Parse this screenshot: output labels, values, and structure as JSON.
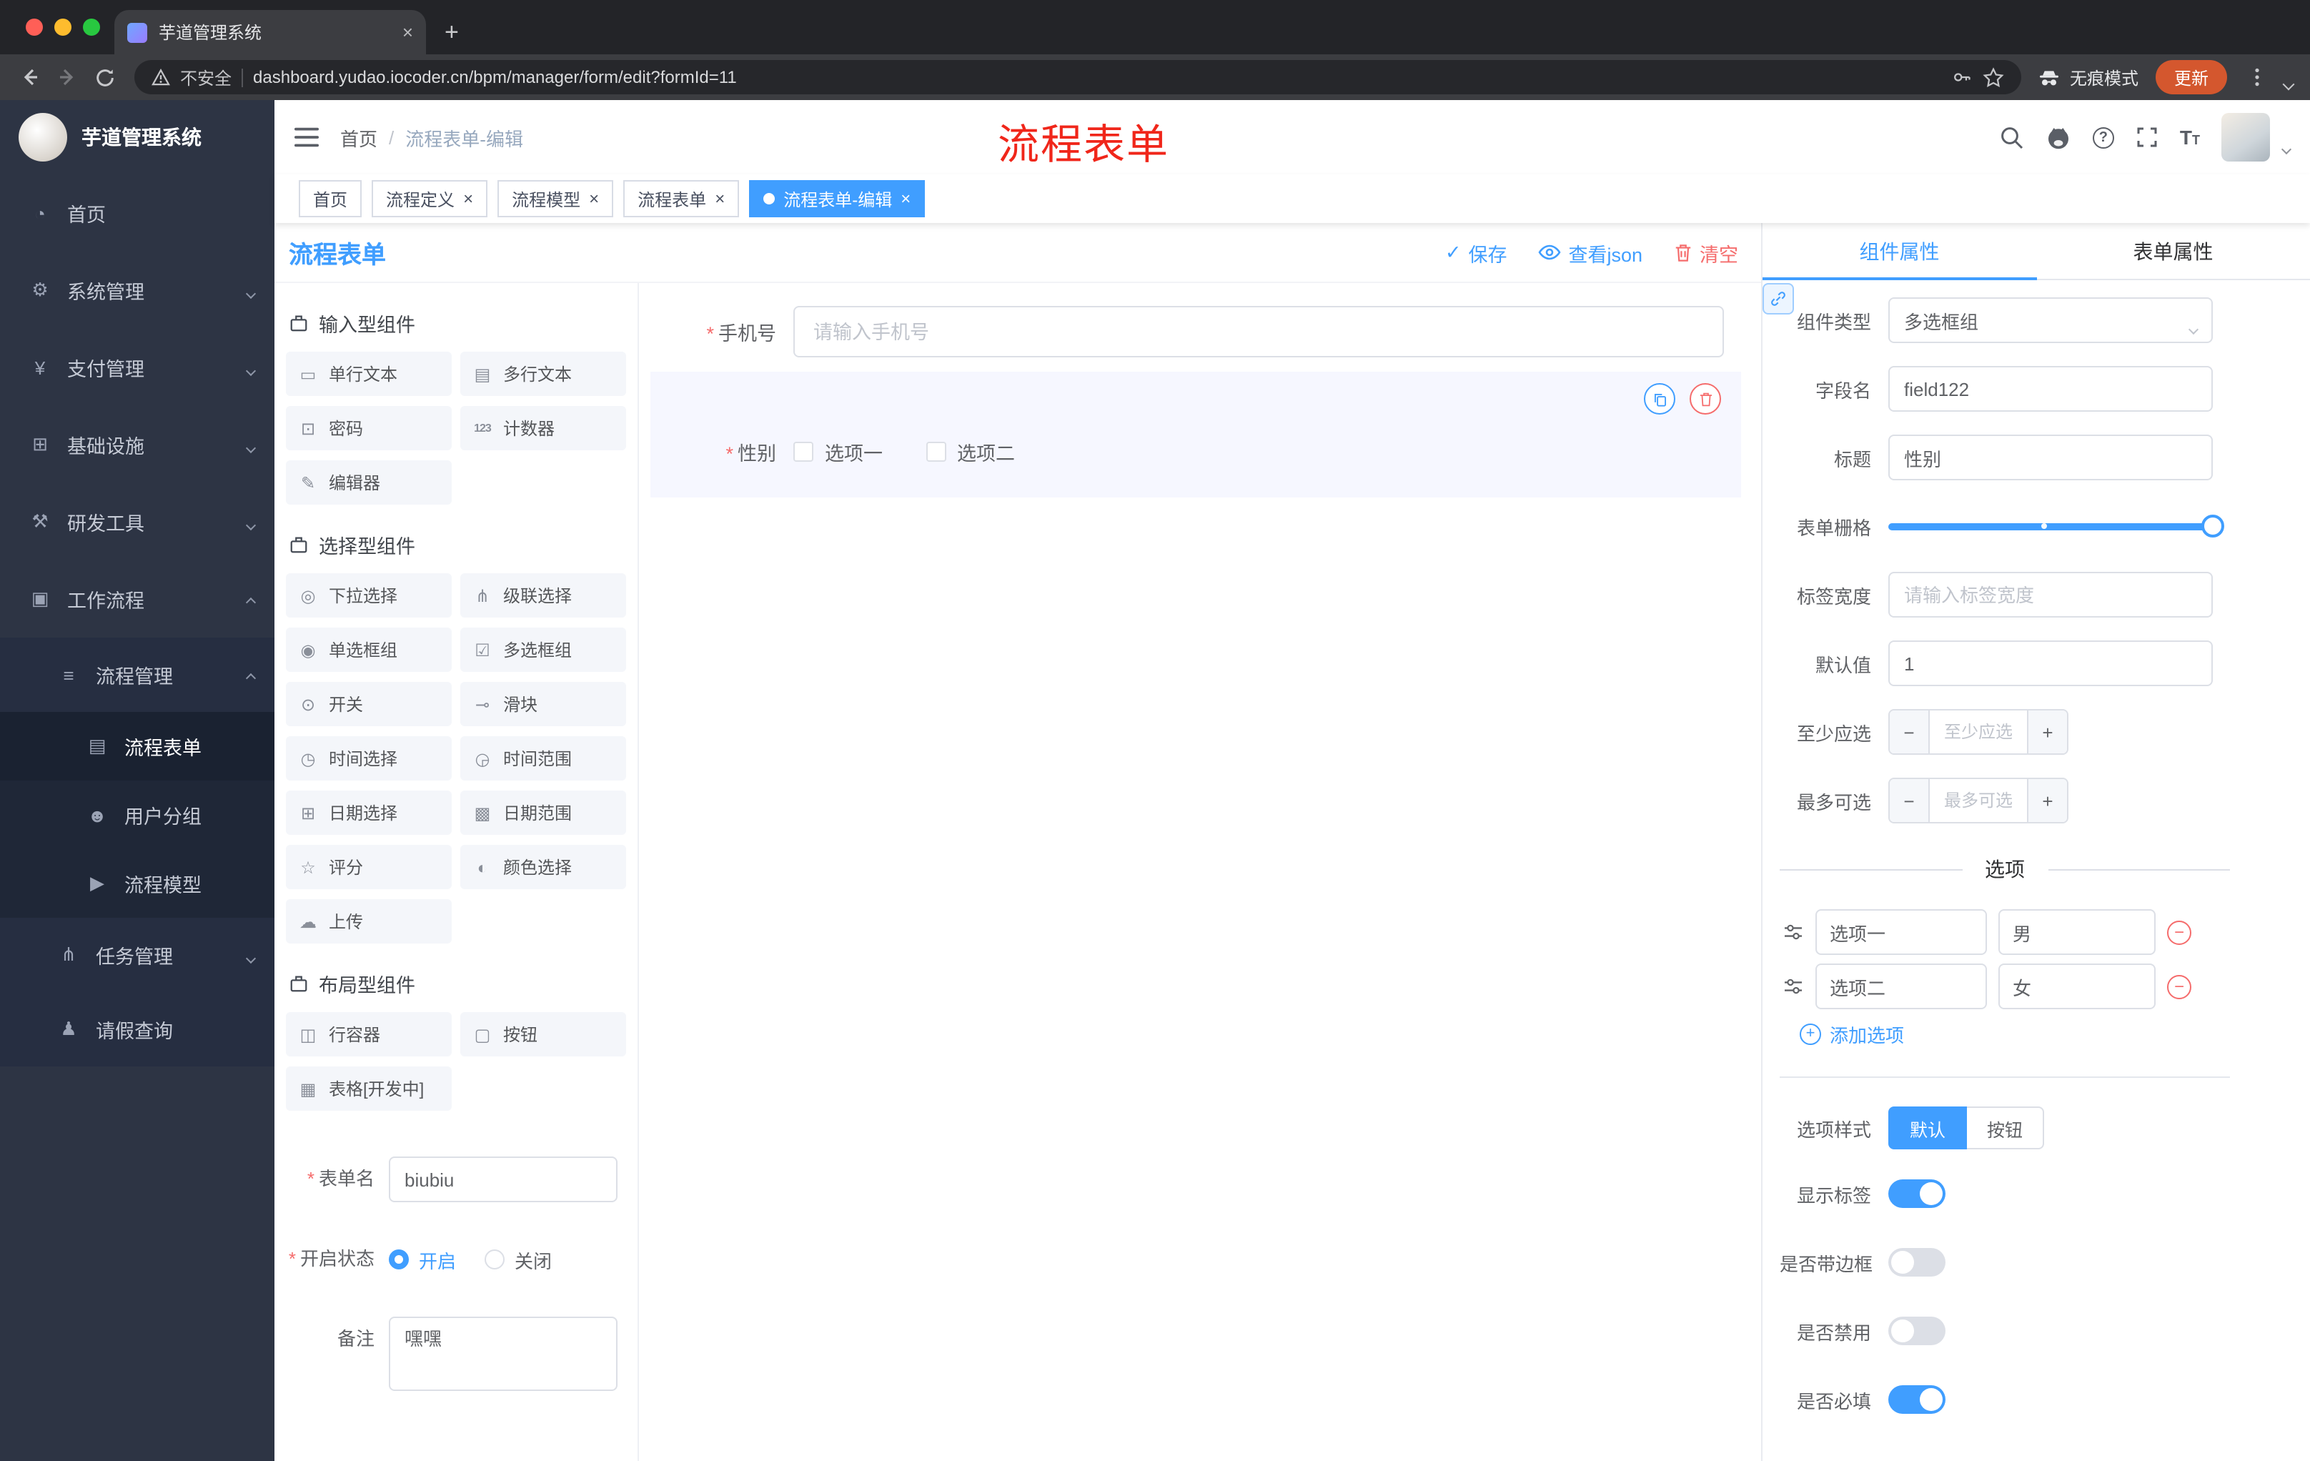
{
  "ui": {
    "minus": "−",
    "plus": "+",
    "close": "×",
    "check": "✓"
  },
  "browser": {
    "tab_title": "芋道管理系统",
    "security_label": "不安全",
    "url": "dashboard.yudao.iocoder.cn/bpm/manager/form/edit?formId=11",
    "incognito_label": "无痕模式",
    "update_label": "更新"
  },
  "sidebar": {
    "logo_title": "芋道管理系统",
    "items": [
      {
        "icon": "◔",
        "label": "首页"
      },
      {
        "icon": "⚙",
        "label": "系统管理"
      },
      {
        "icon": "¥",
        "label": "支付管理"
      },
      {
        "icon": "⊞",
        "label": "基础设施"
      },
      {
        "icon": "⚒",
        "label": "研发工具"
      },
      {
        "icon": "▣",
        "label": "工作流程"
      },
      {
        "icon": "≡",
        "label": "流程管理"
      },
      {
        "icon": "▤",
        "label": "流程表单"
      },
      {
        "icon": "☻",
        "label": "用户分组"
      },
      {
        "icon": "▶",
        "label": "流程模型"
      },
      {
        "icon": "⋔",
        "label": "任务管理"
      },
      {
        "icon": "♟",
        "label": "请假查询"
      }
    ]
  },
  "navbar": {
    "breadcrumb": [
      "首页",
      "流程表单-编辑"
    ],
    "breadcrumb_sep": "/",
    "annotation": "流程表单"
  },
  "tags": [
    {
      "label": "首页"
    },
    {
      "label": "流程定义"
    },
    {
      "label": "流程模型"
    },
    {
      "label": "流程表单"
    },
    {
      "label": "流程表单-编辑"
    }
  ],
  "designer": {
    "title": "流程表单",
    "actions": {
      "save": "保存",
      "view_json": "查看json",
      "clear": "清空"
    },
    "palette": {
      "sections": [
        {
          "title": "输入型组件",
          "items": [
            {
              "icon": "▭",
              "label": "单行文本"
            },
            {
              "icon": "▤",
              "label": "多行文本"
            },
            {
              "icon": "⊡",
              "label": "密码"
            },
            {
              "icon": "123",
              "label": "计数器"
            },
            {
              "icon": "✎",
              "label": "编辑器"
            }
          ]
        },
        {
          "title": "选择型组件",
          "items": [
            {
              "icon": "◎",
              "label": "下拉选择"
            },
            {
              "icon": "⋔",
              "label": "级联选择"
            },
            {
              "icon": "◉",
              "label": "单选框组"
            },
            {
              "icon": "☑",
              "label": "多选框组"
            },
            {
              "icon": "⊙",
              "label": "开关"
            },
            {
              "icon": "⊸",
              "label": "滑块"
            },
            {
              "icon": "◷",
              "label": "时间选择"
            },
            {
              "icon": "◶",
              "label": "时间范围"
            },
            {
              "icon": "⊞",
              "label": "日期选择"
            },
            {
              "icon": "▩",
              "label": "日期范围"
            },
            {
              "icon": "☆",
              "label": "评分"
            },
            {
              "icon": "◐",
              "label": "颜色选择"
            },
            {
              "icon": "☁",
              "label": "上传"
            }
          ]
        },
        {
          "title": "布局型组件",
          "items": [
            {
              "icon": "◫",
              "label": "行容器"
            },
            {
              "icon": "▢",
              "label": "按钮"
            },
            {
              "icon": "▦",
              "label": "表格[开发中]"
            }
          ]
        }
      ]
    },
    "meta": {
      "form_name_label": "表单名",
      "form_name_value": "biubiu",
      "status_label": "开启状态",
      "status_on": "开启",
      "status_off": "关闭",
      "remark_label": "备注",
      "remark_value": "嘿嘿"
    },
    "canvas": {
      "phone": {
        "label": "手机号",
        "placeholder": "请输入手机号"
      },
      "gender": {
        "label": "性别",
        "options": [
          "选项一",
          "选项二"
        ]
      }
    }
  },
  "props": {
    "tabs": [
      "组件属性",
      "表单属性"
    ],
    "component_type": {
      "label": "组件类型",
      "value": "多选框组"
    },
    "field_name": {
      "label": "字段名",
      "value": "field122"
    },
    "title_field": {
      "label": "标题",
      "value": "性别"
    },
    "grid": {
      "label": "表单栅格"
    },
    "label_width": {
      "label": "标签宽度",
      "placeholder": "请输入标签宽度"
    },
    "default_value": {
      "label": "默认值",
      "value": "1"
    },
    "min_select": {
      "label": "至少应选",
      "placeholder": "至少应选"
    },
    "max_select": {
      "label": "最多可选",
      "placeholder": "最多可选"
    },
    "options_title": "选项",
    "options": [
      {
        "name": "选项一",
        "value": "男"
      },
      {
        "name": "选项二",
        "value": "女"
      }
    ],
    "add_option": "添加选项",
    "option_style": {
      "label": "选项样式",
      "opt_default": "默认",
      "opt_button": "按钮"
    },
    "toggles": [
      {
        "label": "显示标签"
      },
      {
        "label": "是否带边框"
      },
      {
        "label": "是否禁用"
      },
      {
        "label": "是否必填"
      }
    ]
  },
  "colors": {
    "accent": "#409eff",
    "danger": "#f56c6c",
    "annotation": "#f0261a",
    "update_pill": "#d4572e"
  }
}
